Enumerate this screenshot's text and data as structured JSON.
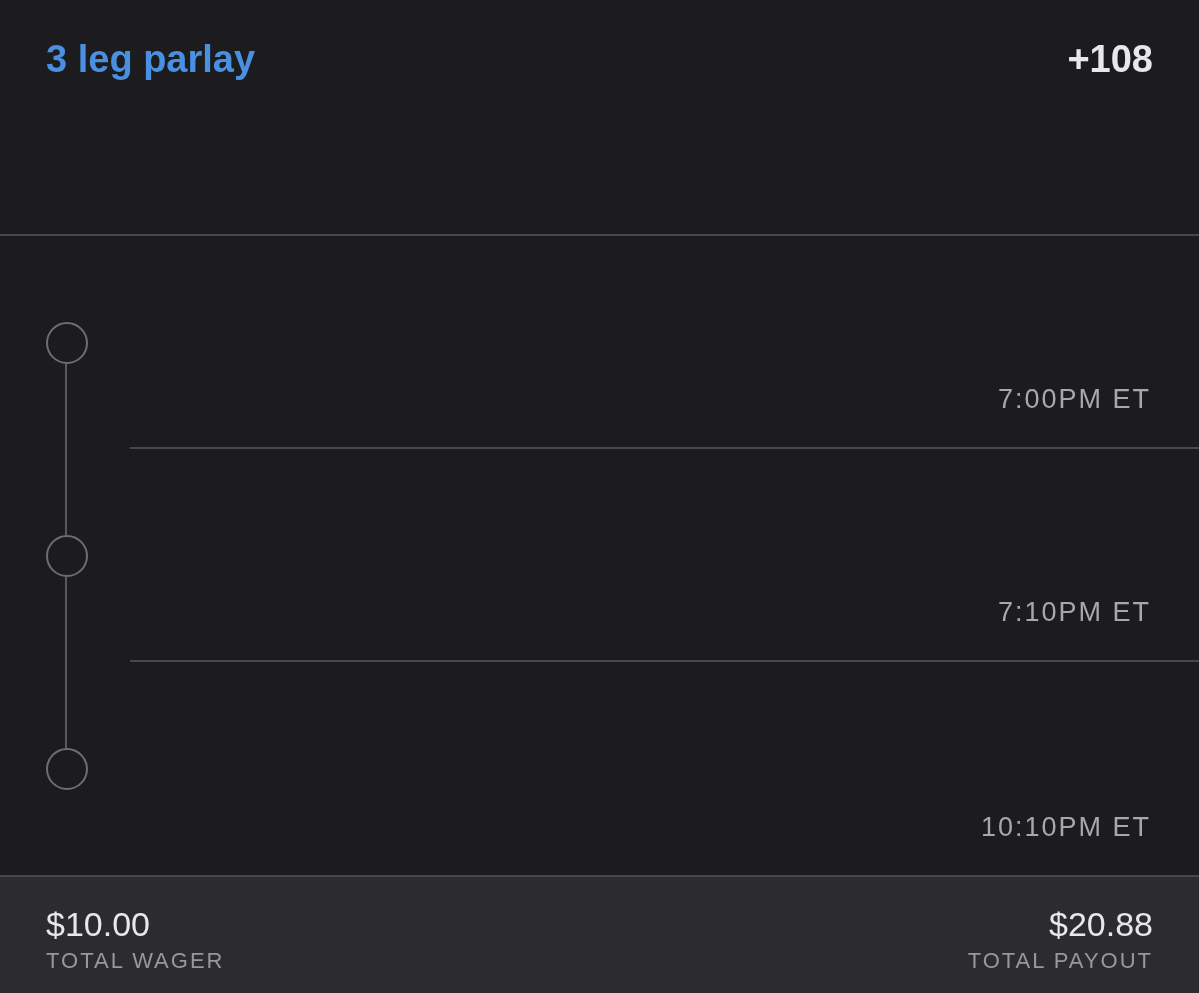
{
  "header": {
    "title": "3 leg parlay",
    "odds": "+108"
  },
  "legs": [
    {
      "time": "7:00PM ET"
    },
    {
      "time": "7:10PM ET"
    },
    {
      "time": "10:10PM ET"
    }
  ],
  "footer": {
    "wager": {
      "amount": "$10.00",
      "label": "TOTAL WAGER"
    },
    "payout": {
      "amount": "$20.88",
      "label": "TOTAL PAYOUT"
    }
  }
}
